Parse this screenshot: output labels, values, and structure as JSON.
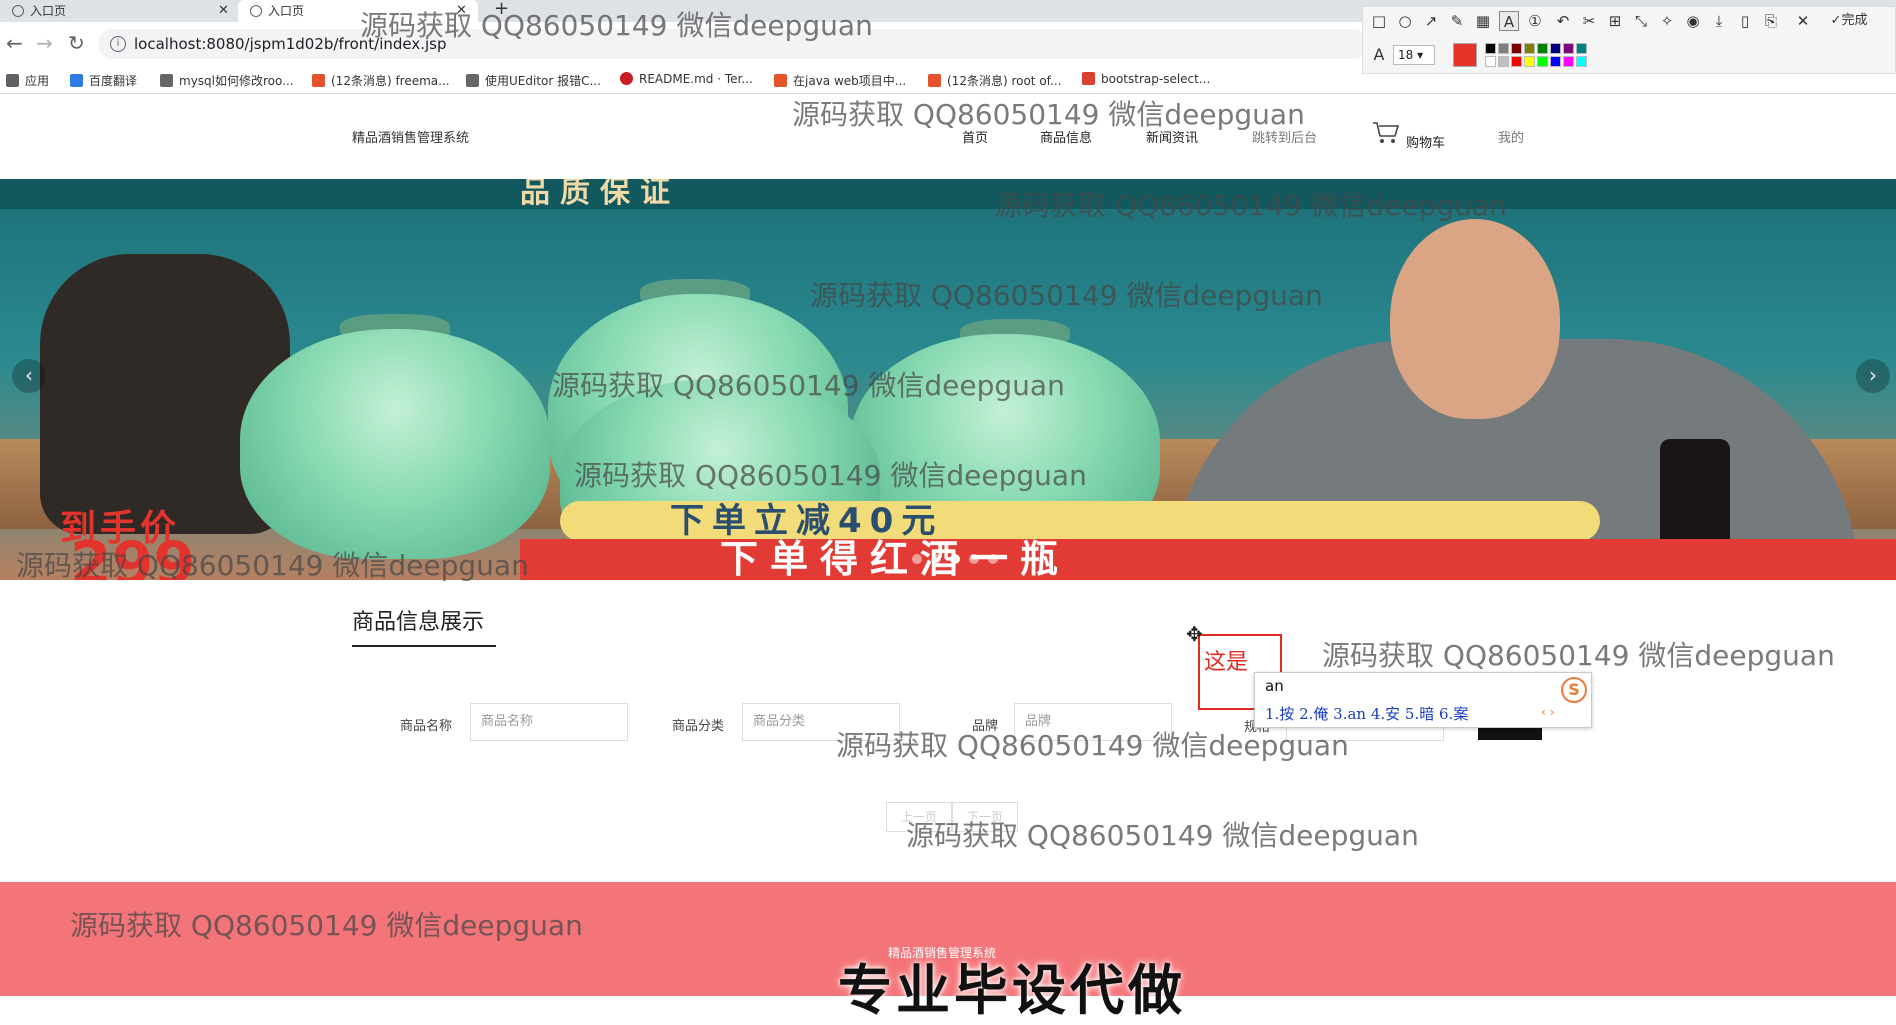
{
  "browser": {
    "tabs": [
      {
        "title": "入口页",
        "close": "✕"
      },
      {
        "title": "入口页",
        "close": "✕"
      }
    ],
    "new_tab": "+",
    "url": "localhost:8080/jspm1d02b/front/index.jsp",
    "bookmarks": [
      "应用",
      "百度翻译",
      "mysql如何修改roo...",
      "(12条消息) freema...",
      "使用UEditor 报错C...",
      "README.md · Ter...",
      "在java web项目中...",
      "(12条消息) root of...",
      "bootstrap-select..."
    ]
  },
  "screenshot_tool": {
    "font_size": "18",
    "confirm_label": "完成",
    "selected_color": "#e6332a",
    "palette": [
      "#000000",
      "#808080",
      "#800000",
      "#808000",
      "#008000",
      "#000080",
      "#800080",
      "#008080",
      "#ffffff",
      "#c0c0c0",
      "#ff0000",
      "#ffff00",
      "#00ff00",
      "#0000ff",
      "#ff00ff",
      "#00ffff"
    ]
  },
  "site": {
    "brand": "精品酒销售管理系统",
    "nav": [
      "首页",
      "商品信息",
      "新闻资讯",
      "跳转到后台",
      "购物车",
      "我的"
    ]
  },
  "banner": {
    "headline": "品质保证",
    "price_label": "到手价",
    "price_value": "299",
    "promo_line1": "下单立减40元",
    "promo_line2": "下单得红酒一瓶",
    "prev": "‹",
    "next": "›"
  },
  "section": {
    "title": "商品信息展示"
  },
  "filters": [
    {
      "label": "商品名称",
      "placeholder": "商品名称"
    },
    {
      "label": "商品分类",
      "placeholder": "商品分类"
    },
    {
      "label": "品牌",
      "placeholder": "品牌"
    },
    {
      "label": "规格",
      "placeholder": ""
    }
  ],
  "pager": {
    "prev": "上一页",
    "next": "下一页"
  },
  "annotation": {
    "text": "这是"
  },
  "ime": {
    "composition": "an",
    "candidates": "1.按  2.俺  3.an  4.安  5.暗  6.案",
    "nav": "‹ ›",
    "logo": "S"
  },
  "footer": {
    "text": "精品酒销售管理系统"
  },
  "overlay_caption": "专业毕设代做",
  "watermark": "源码获取 QQ86050149 微信deepguan"
}
